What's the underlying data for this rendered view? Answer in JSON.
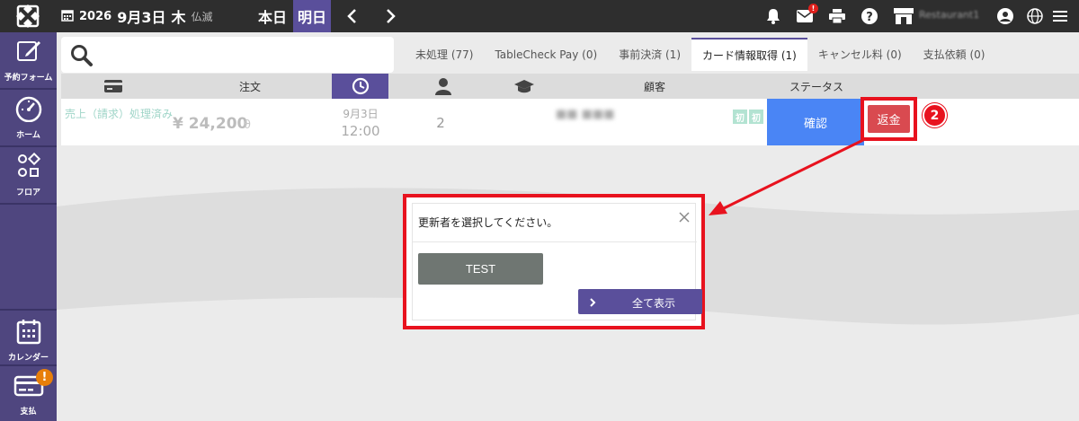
{
  "header": {
    "date_year": "2026",
    "date_month_day": "9月3日",
    "date_weekday": "木",
    "date_rokuyo": "仏滅",
    "today_label": "本日",
    "tomorrow_label": "明日",
    "mail_badge": "!",
    "restaurant_name": "Restaurant1"
  },
  "sidebar": {
    "items": [
      {
        "label": "予約フォーム",
        "icon": "edit-icon"
      },
      {
        "label": "ホーム",
        "icon": "gauge-icon"
      },
      {
        "label": "フロア",
        "icon": "shapes-icon"
      },
      {
        "label": "カレンダー",
        "icon": "calendar-icon"
      },
      {
        "label": "支払",
        "icon": "credit-card-icon",
        "alert": "!"
      }
    ]
  },
  "search": {
    "placeholder": "",
    "value": ""
  },
  "tabs": [
    {
      "label": "未処理 (77)",
      "active": false
    },
    {
      "label": "TableCheck Pay (0)",
      "active": false
    },
    {
      "label": "事前決済 (1)",
      "active": false
    },
    {
      "label": "カード情報取得 (1)",
      "active": true
    },
    {
      "label": "キャンセル料 (0)",
      "active": false
    },
    {
      "label": "支払依頼 (0)",
      "active": false
    }
  ],
  "table": {
    "headers": {
      "order": "注文",
      "customer": "顧客",
      "status": "ステータス"
    },
    "row": {
      "sales_status": "売上（請求）処理済み",
      "amount": "¥ 24,200",
      "amount_suffix": "θ",
      "date": "9月3日",
      "time": "12:00",
      "guests": "2",
      "customer_name": "■■ ■■■",
      "first_badge_1": "初",
      "first_badge_2": "初",
      "confirm_label": "確認",
      "refund_label": "返金"
    }
  },
  "step_number": "2",
  "dialog": {
    "title": "更新者を選択してください。",
    "staff_button": "TEST",
    "show_all_label": "全て表示"
  },
  "colors": {
    "accent_purple": "#5a4f9b",
    "highlight_red": "#e8121e",
    "confirm_blue": "#4a85f5",
    "refund_red": "#d94a50",
    "topbar": "#2e2e2e"
  }
}
